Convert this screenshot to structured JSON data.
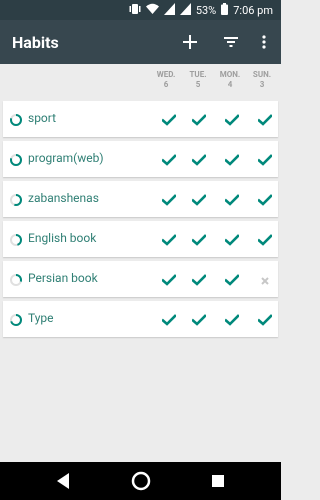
{
  "status_bar": {
    "battery": "53%",
    "time": "7:06 pm"
  },
  "toolbar": {
    "title": "Habits",
    "add_icon": "plus-icon",
    "filter_icon": "filter-icon",
    "menu_icon": "more-vert-icon"
  },
  "days": [
    {
      "name": "WED.",
      "num": "6"
    },
    {
      "name": "TUE.",
      "num": "5"
    },
    {
      "name": "MON.",
      "num": "4"
    },
    {
      "name": "SUN.",
      "num": "3"
    }
  ],
  "habits": [
    {
      "name": "sport",
      "marks": [
        "check",
        "check",
        "check",
        "check"
      ]
    },
    {
      "name": "program(web)",
      "marks": [
        "check",
        "check",
        "check",
        "check"
      ]
    },
    {
      "name": "zabanshenas",
      "marks": [
        "check",
        "check",
        "check",
        "check"
      ]
    },
    {
      "name": "English book",
      "marks": [
        "check",
        "check",
        "check",
        "check"
      ]
    },
    {
      "name": "Persian book",
      "marks": [
        "check",
        "check",
        "check",
        "cross"
      ]
    },
    {
      "name": "Type",
      "marks": [
        "check",
        "check",
        "check",
        "check"
      ]
    }
  ],
  "colors": {
    "toolbar": "#37474f",
    "statusbar": "#2d3e45",
    "accent": "#00897b",
    "text_accent": "#2f7f74",
    "cross": "#c7c7c7"
  },
  "nav": {
    "back_icon": "back-triangle-icon",
    "home_icon": "home-circle-icon",
    "recents_icon": "recents-square-icon"
  }
}
